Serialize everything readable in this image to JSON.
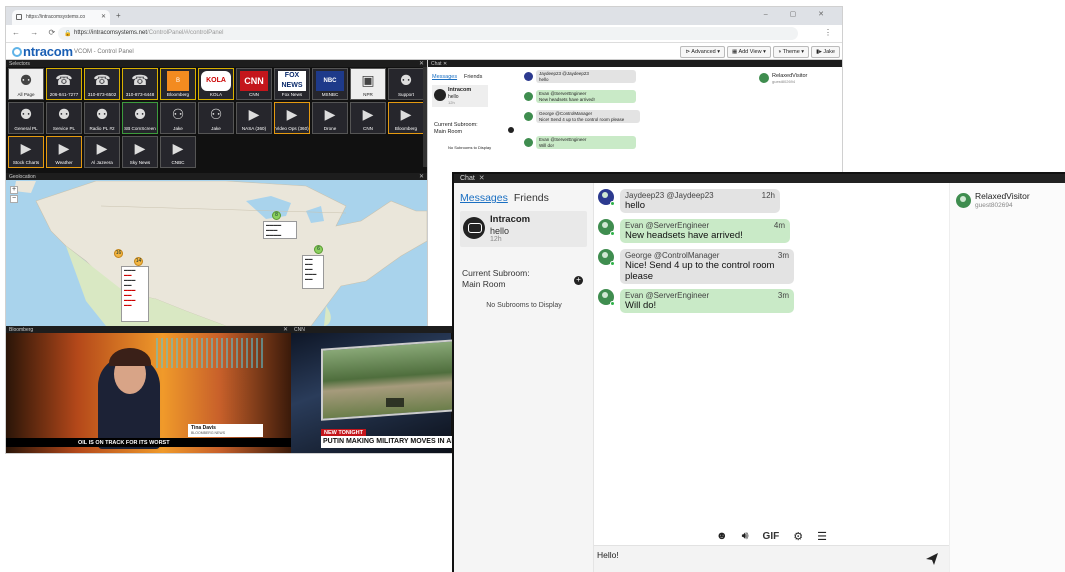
{
  "browser": {
    "tab_title": "https://intracomsystems.co",
    "url_host": "https://intracomsystems.net",
    "url_path": "/ControlPanel/#/controlPanel",
    "app_subtitle": "VCOM - Control Panel",
    "logo_text": "ntracom",
    "menus": [
      "⊳ Advanced ▾",
      "▦ Add View ▾",
      "◑ Theme ▾",
      "▮▸ Jake"
    ]
  },
  "selectors": {
    "title": "Selectors",
    "cells": [
      {
        "label": "All Page",
        "icon": "group-icon",
        "style": "white"
      },
      {
        "label": "206-841-7277",
        "icon": "phone-icon",
        "style": "yellow"
      },
      {
        "label": "310-873-6502",
        "icon": "phone-icon",
        "style": "yellow"
      },
      {
        "label": "310-873-6448",
        "icon": "phone-icon",
        "style": "yellow"
      },
      {
        "label": "Bloomberg",
        "icon": "bloomberg-logo",
        "style": "yellow"
      },
      {
        "label": "KOLA",
        "icon": "kola-logo",
        "style": "yellow"
      },
      {
        "label": "CNN",
        "icon": "cnn-logo",
        "style": "plain"
      },
      {
        "label": "Fox News",
        "icon": "fox-logo",
        "style": "plain"
      },
      {
        "label": "MSNBC",
        "icon": "nbc-logo",
        "style": "plain"
      },
      {
        "label": "NPR",
        "icon": "radio-icon",
        "style": "white"
      },
      {
        "label": "Support",
        "icon": "group-icon",
        "style": "plain"
      },
      {
        "label": "General PL",
        "icon": "group-icon",
        "style": "plain"
      },
      {
        "label": "Service PL",
        "icon": "group-icon",
        "style": "plain"
      },
      {
        "label": "Radio PL #2",
        "icon": "group-icon",
        "style": "plain"
      },
      {
        "label": "SB ComScreen",
        "icon": "group-icon",
        "style": "greenb"
      },
      {
        "label": "Jake",
        "icon": "person-icon",
        "style": "plain"
      },
      {
        "label": "Jake",
        "icon": "person-icon",
        "style": "plain"
      },
      {
        "label": "NASA (360)",
        "icon": "video-icon",
        "style": "plain"
      },
      {
        "label": "Video Ops (360)",
        "icon": "video-icon",
        "style": "orange"
      },
      {
        "label": "Drone",
        "icon": "video-icon",
        "style": "plain"
      },
      {
        "label": "CNN",
        "icon": "video-icon",
        "style": "plain"
      },
      {
        "label": "Bloomberg",
        "icon": "video-icon",
        "style": "orange"
      },
      {
        "label": "Stock Charts",
        "icon": "video-icon",
        "style": "orange"
      },
      {
        "label": "Weather",
        "icon": "video-icon",
        "style": "orange"
      },
      {
        "label": "Al Jazeera",
        "icon": "video-icon",
        "style": "plain"
      },
      {
        "label": "Sky News",
        "icon": "video-icon",
        "style": "plain"
      },
      {
        "label": "CNBC",
        "icon": "video-icon",
        "style": "plain"
      }
    ]
  },
  "geo": {
    "title": "Geolocation",
    "zoom_in": "+",
    "zoom_out": "−"
  },
  "video": {
    "bloomberg_title": "Bloomberg",
    "bloomberg_name": "Tina Davis",
    "bloomberg_org": "BLOOMBERG NEWS",
    "bloomberg_ticker": "OIL IS ON TRACK FOR ITS WORST",
    "cnn_title": "CNN",
    "cnn_tag": "NEW TONIGHT",
    "cnn_headline": "PUTIN MAKING MILITARY MOVES IN AMER"
  },
  "chat": {
    "window_title": "Chat",
    "close": "✕",
    "tabs": {
      "messages": "Messages",
      "friends": "Friends"
    },
    "conversation": {
      "name": "Intracom",
      "last": "hello",
      "time": "12h"
    },
    "subroom_label": "Current Subroom:",
    "subroom_value": "Main Room",
    "no_subrooms": "No Subrooms to Display",
    "messages": [
      {
        "header": "Jaydeep23 @Jaydeep23",
        "time": "12h",
        "text": "hello",
        "avatar": "blue",
        "bubble": "gray"
      },
      {
        "header": "Evan @ServerEngineer",
        "time": "4m",
        "text": "New headsets have arrived!",
        "avatar": "green",
        "bubble": "green"
      },
      {
        "header": "George @ControlManager",
        "time": "3m",
        "text": "Nice! Send 4 up to the control room please",
        "avatar": "green",
        "bubble": "gray"
      },
      {
        "header": "Evan @ServerEngineer",
        "time": "3m",
        "text": "Will do!",
        "avatar": "green",
        "bubble": "green"
      }
    ],
    "user": {
      "name": "RelaxedVisitor",
      "id": "guest802694"
    },
    "toolbar": {
      "gif": "GIF"
    },
    "composer_value": "Hello!"
  },
  "colors": {
    "accent_link": "#1a6fc2",
    "bubble_green": "#c9eac7",
    "bubble_gray": "#e3e3e3",
    "online_green": "#2fb24a"
  }
}
